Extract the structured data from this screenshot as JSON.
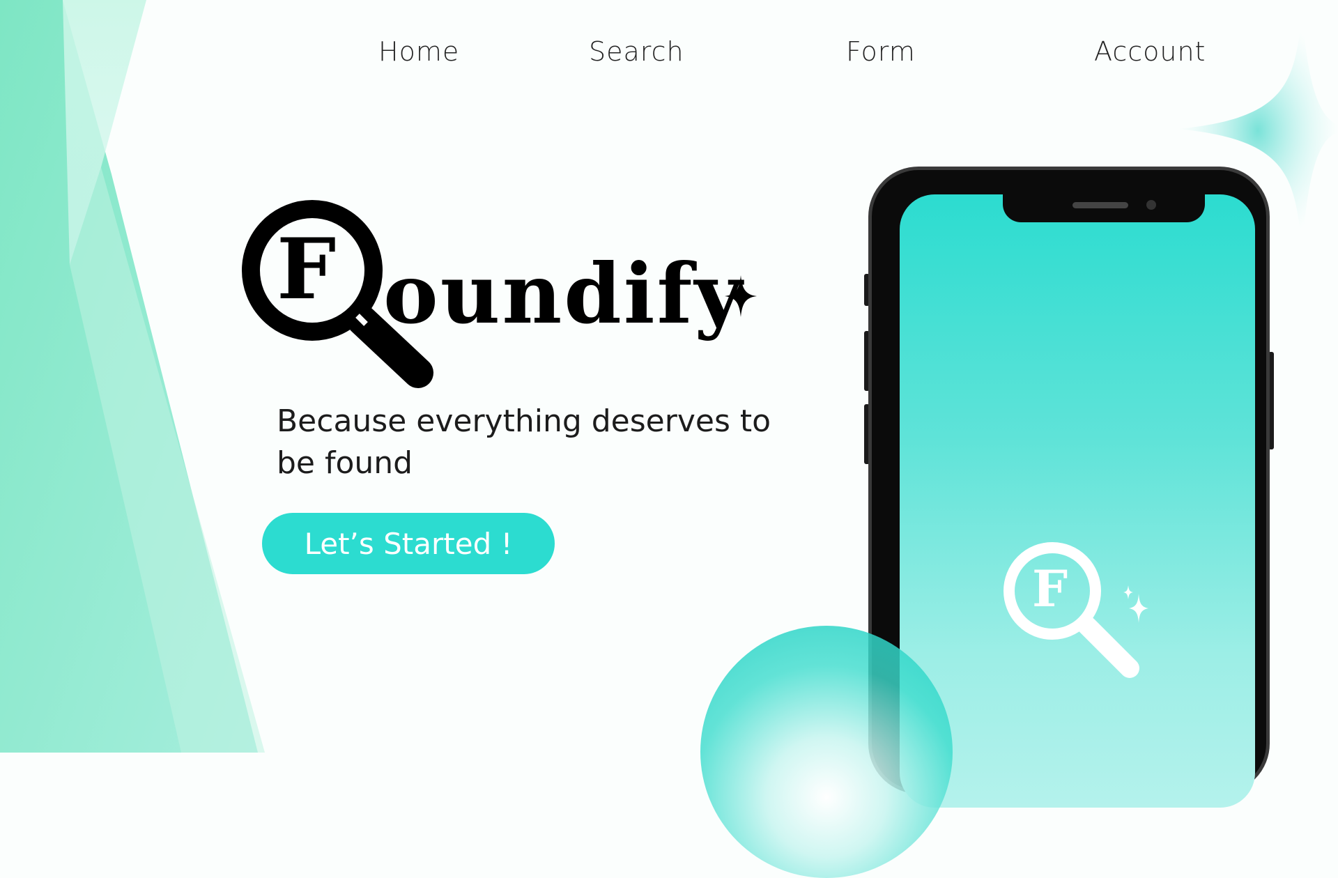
{
  "nav": {
    "home": "Home",
    "search": "Search",
    "form": "Form",
    "account": "Account"
  },
  "hero": {
    "logo_text": "oundify",
    "logo_letter": "F",
    "tagline": "Because everything deserves to be found",
    "cta_label": "Let’s Started !"
  },
  "phone": {
    "app_icon_letter": "F"
  },
  "colors": {
    "accent": "#2cdcd0",
    "shard_light": "#b4f0dc",
    "shard_mid": "#8fe6c8",
    "text_dark": "#1c1c1c"
  },
  "icons": [
    "magnifier-icon",
    "sparkle-icon",
    "star-icon"
  ]
}
